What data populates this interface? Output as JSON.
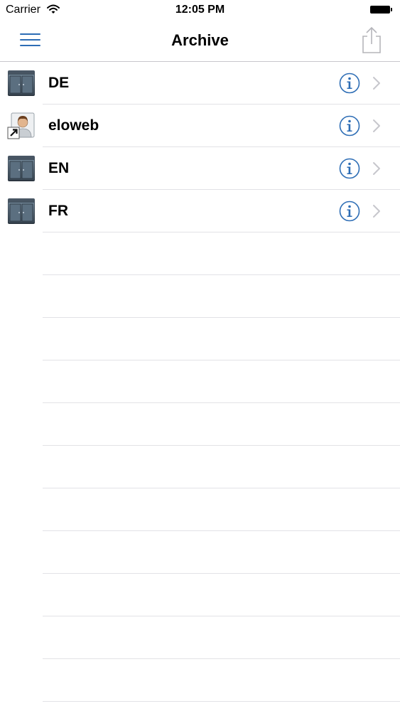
{
  "status_bar": {
    "carrier": "Carrier",
    "time": "12:05 PM",
    "wifi_icon": "wifi-icon",
    "battery_icon": "battery-icon"
  },
  "nav": {
    "title": "Archive",
    "menu_icon": "hamburger-menu-icon",
    "share_icon": "share-icon",
    "accent_color": "#2d6db5"
  },
  "archive_list": [
    {
      "label": "DE",
      "icon": "cabinet-icon"
    },
    {
      "label": "eloweb",
      "icon": "user-shortcut-icon"
    },
    {
      "label": "EN",
      "icon": "cabinet-icon"
    },
    {
      "label": "FR",
      "icon": "cabinet-icon"
    }
  ],
  "row_accessories": {
    "info_icon": "info-icon",
    "chevron_icon": "chevron-right-icon",
    "chevron_color": "#c7c7cc"
  }
}
